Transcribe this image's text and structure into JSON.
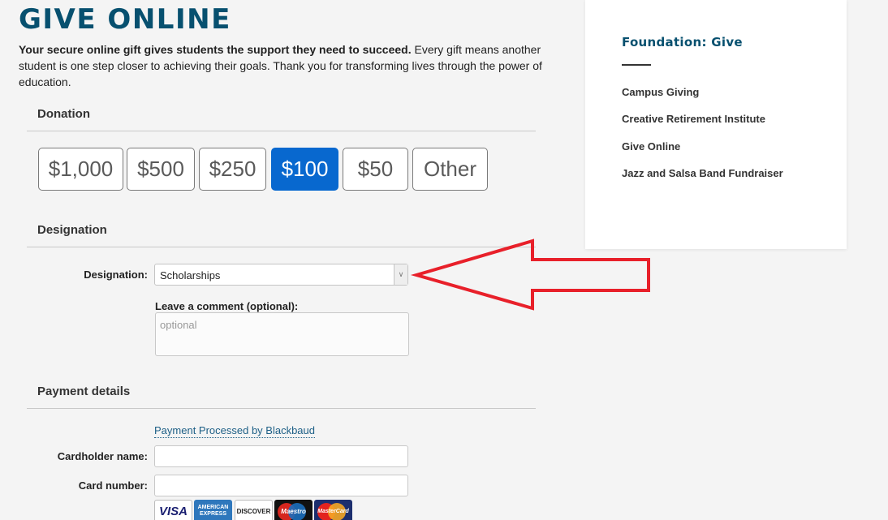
{
  "header": {
    "title": "GIVE ONLINE",
    "intro_bold": "Your secure online gift gives students the support they need to succeed.",
    "intro_rest": " Every gift means another student is one step closer to achieving their goals. Thank you for transforming lives through the power of education."
  },
  "donation": {
    "section_title": "Donation",
    "amounts": [
      {
        "label": "$1,000",
        "selected": false
      },
      {
        "label": "$500",
        "selected": false
      },
      {
        "label": "$250",
        "selected": false
      },
      {
        "label": "$100",
        "selected": true
      },
      {
        "label": "$50",
        "selected": false
      },
      {
        "label": "Other",
        "selected": false
      }
    ]
  },
  "designation": {
    "section_title": "Designation",
    "field_label": "Designation:",
    "selected_value": "Scholarships",
    "comment_label": "Leave a comment (optional):",
    "comment_placeholder": "optional"
  },
  "payment": {
    "section_title": "Payment details",
    "processor_link": "Payment Processed by Blackbaud",
    "cardholder_label": "Cardholder name:",
    "card_number_label": "Card number:",
    "cards": [
      "VISA",
      "AMERICAN EXPRESS",
      "DISCOVER",
      "Maestro",
      "MasterCard"
    ]
  },
  "sidebar": {
    "title": "Foundation: Give",
    "items": [
      {
        "label": "Campus Giving"
      },
      {
        "label": "Creative Retirement Institute"
      },
      {
        "label": "Give Online"
      },
      {
        "label": "Jazz and Salsa Band Fundraiser"
      }
    ]
  },
  "annotation": {
    "arrow_color": "#e8202a",
    "target": "designation-select"
  }
}
